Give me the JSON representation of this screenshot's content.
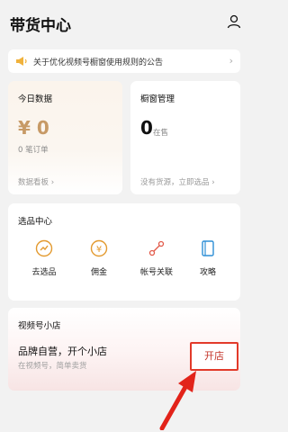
{
  "header": {
    "title": "带货中心"
  },
  "notice": {
    "text": "关于优化视频号橱窗使用规则的公告"
  },
  "data_card": {
    "label": "今日数据",
    "amount": "¥ 0",
    "orders": "0 笔订单",
    "link": "数据看板 ›"
  },
  "window_card": {
    "label": "橱窗管理",
    "count": "0",
    "unit": "在售",
    "link": "没有货源，立即选品 ›"
  },
  "select_card": {
    "title": "选品中心",
    "items": [
      {
        "label": "去选品",
        "icon": "select-product-icon"
      },
      {
        "label": "佣金",
        "icon": "commission-icon"
      },
      {
        "label": "帐号关联",
        "icon": "account-link-icon"
      },
      {
        "label": "攻略",
        "icon": "guide-book-icon"
      }
    ]
  },
  "shop_card": {
    "title": "视频号小店",
    "main": "品牌自营，开个小店",
    "sub": "在视频号，简单卖货",
    "button": "开店"
  },
  "colors": {
    "accent_gold": "#c79a66",
    "highlight_red": "#e23a2a"
  }
}
